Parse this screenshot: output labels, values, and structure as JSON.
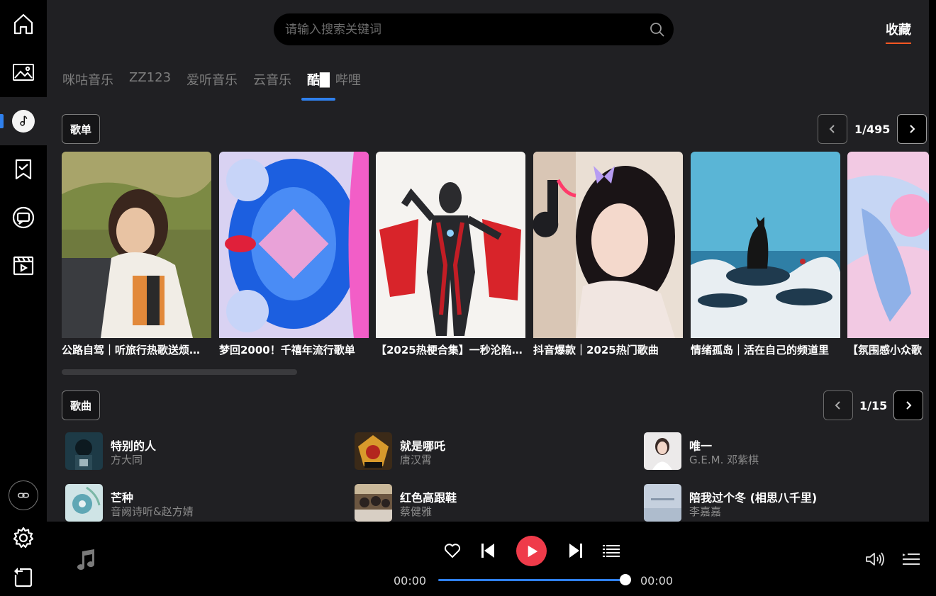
{
  "sidebar": {
    "icons": [
      "home-icon",
      "image-icon",
      "music-note-icon",
      "bookmark-icon",
      "chat-icon",
      "video-icon",
      "link-logo-icon",
      "gear-icon",
      "export-icon"
    ],
    "active_index": 2
  },
  "header": {
    "search_placeholder": "请输入搜索关键词",
    "favorites_label": "收藏"
  },
  "tabs": [
    {
      "label": "咪咕音乐",
      "active": false
    },
    {
      "label": "ZZ123",
      "active": false
    },
    {
      "label": "爱听音乐",
      "active": false
    },
    {
      "label": "云音乐",
      "active": false
    },
    {
      "label": "酷█",
      "active": true
    },
    {
      "label": "哔哩",
      "active": false
    }
  ],
  "playlists_section": {
    "label": "歌单",
    "page_indicator": "1/495",
    "items": [
      {
        "title": "公路自驾｜听旅行热歌送烦…"
      },
      {
        "title": "梦回2000！千禧年流行歌单"
      },
      {
        "title": "【2025热梗合集】一秒沦陷…"
      },
      {
        "title": "抖音爆款｜2025热门歌曲"
      },
      {
        "title": "情绪孤岛｜活在自己的频道里"
      },
      {
        "title": "【氛围感小众歌"
      }
    ]
  },
  "songs_section": {
    "label": "歌曲",
    "page_indicator": "1/15",
    "items": [
      {
        "title": "特别的人",
        "artist": "方大同"
      },
      {
        "title": "就是哪吒",
        "artist": "唐汉霄"
      },
      {
        "title": "唯一",
        "artist": "G.E.M. 邓紫棋"
      },
      {
        "title": "芒种",
        "artist": "音阙诗听&赵方婧"
      },
      {
        "title": "红色高跟鞋",
        "artist": "蔡健雅"
      },
      {
        "title": "陪我过个冬 (相思八千里)",
        "artist": "李嘉嘉"
      }
    ]
  },
  "player": {
    "current_time": "00:00",
    "total_time": "00:00",
    "progress": 1.0,
    "accent_color": "#ef3b4a",
    "progress_color": "#2f80ed"
  }
}
